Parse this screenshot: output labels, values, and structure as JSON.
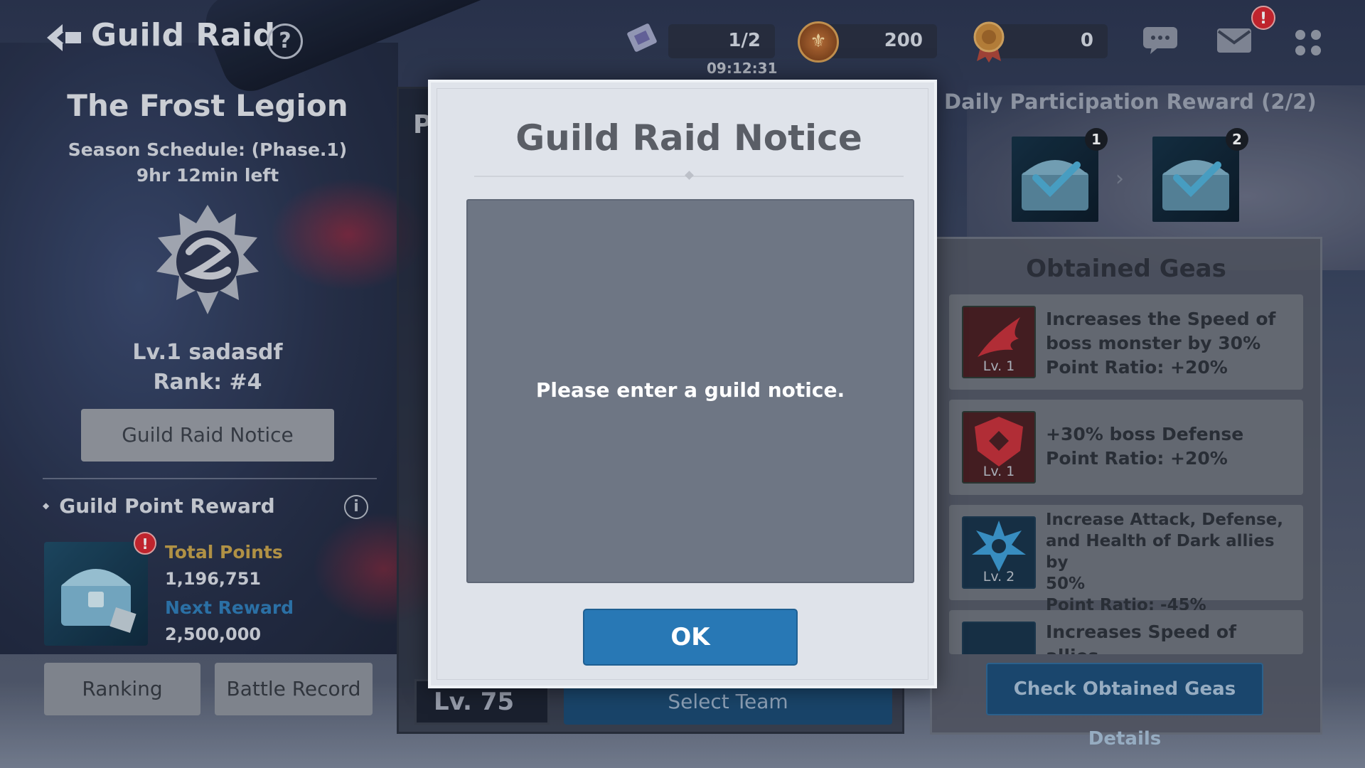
{
  "header": {
    "title": "Guild Raid",
    "help_label": "?",
    "tickets": "1/2",
    "ticket_timer": "09:12:31",
    "coins": "200",
    "medals": "0",
    "mail_alert": "!"
  },
  "guild": {
    "name": "The Frost Legion",
    "season": "Season Schedule: (Phase.1)",
    "time_left": "9hr 12min left",
    "player": "Lv.1 sadasdf",
    "rank": "Rank: #4",
    "notice_button": "Guild Raid Notice"
  },
  "reward": {
    "section_label": "Guild Point Reward",
    "info_label": "i",
    "alert": "!",
    "total_points_label": "Total Points",
    "total_points": "1,196,751",
    "next_reward_label": "Next Reward",
    "next_reward": "2,500,000",
    "ranking_button": "Ranking",
    "battle_record_button": "Battle Record"
  },
  "middle": {
    "partial_heading": "P",
    "level": "Lv. 75",
    "select_button": "Select Team"
  },
  "daily": {
    "title": "Daily Participation Reward (2/2)",
    "chests": [
      "1",
      "2"
    ]
  },
  "geas": {
    "title": "Obtained Geas",
    "items": [
      {
        "level": "Lv. 1",
        "lines": [
          "Increases the Speed of",
          "boss monster by 30%",
          "Point Ratio: +20%"
        ]
      },
      {
        "level": "Lv. 1",
        "lines": [
          "+30% boss Defense",
          "Point Ratio: +20%"
        ]
      },
      {
        "level": "Lv. 2",
        "lines": [
          "Increase Attack, Defense,",
          "and Health of Dark allies by",
          "50%",
          "Point Ratio: -45%"
        ]
      },
      {
        "level": "",
        "lines": [
          "Increases Speed of allies"
        ]
      }
    ],
    "details_button": "Check Obtained Geas Details"
  },
  "modal": {
    "title": "Guild Raid Notice",
    "message": "Please enter a guild notice.",
    "ok_button": "OK"
  },
  "colors": {
    "accent_blue": "#2878b5",
    "gold_label": "#c7a24a",
    "blue_label": "#2f7db8",
    "alert_red": "#d8262f"
  }
}
